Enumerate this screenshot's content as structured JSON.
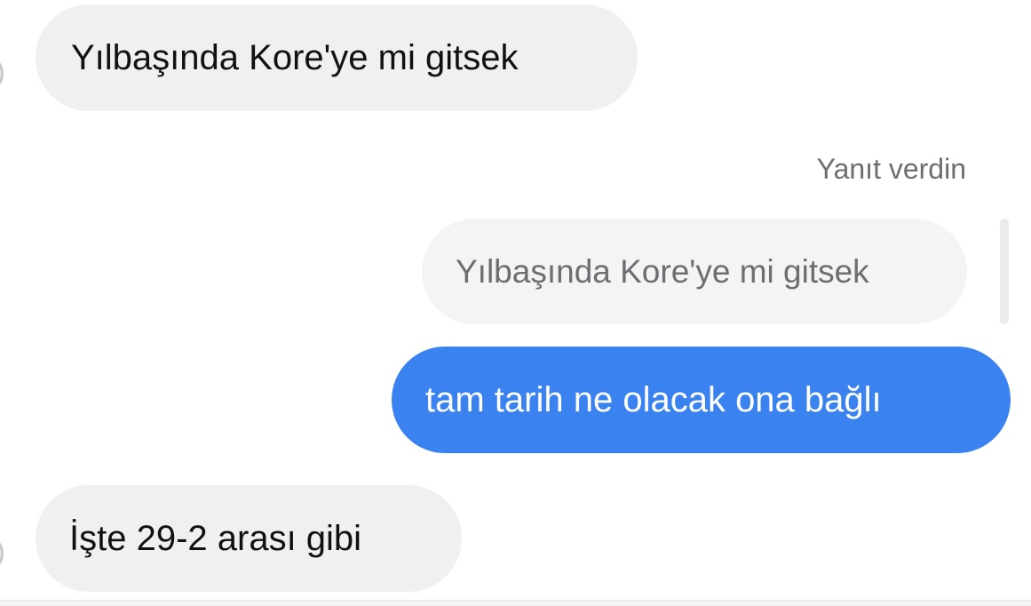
{
  "conversation": {
    "messages": [
      {
        "direction": "incoming",
        "text": "Yılbaşında Kore'ye mi gitsek"
      },
      {
        "direction": "outgoing",
        "reply_note": "Yanıt verdin",
        "replied_text": "Yılbaşında Kore'ye mi gitsek",
        "text": "tam tarih ne olacak ona bağlı"
      },
      {
        "direction": "incoming",
        "text": "İşte 29-2 arası gibi"
      }
    ]
  },
  "colors": {
    "outgoing_bubble": "#3b82f1",
    "incoming_bubble": "#f0f0f0",
    "reply_preview_bubble": "#f4f4f4",
    "secondary_text": "#6d6d72"
  },
  "icons": {
    "avatar": "avatar-icon"
  }
}
